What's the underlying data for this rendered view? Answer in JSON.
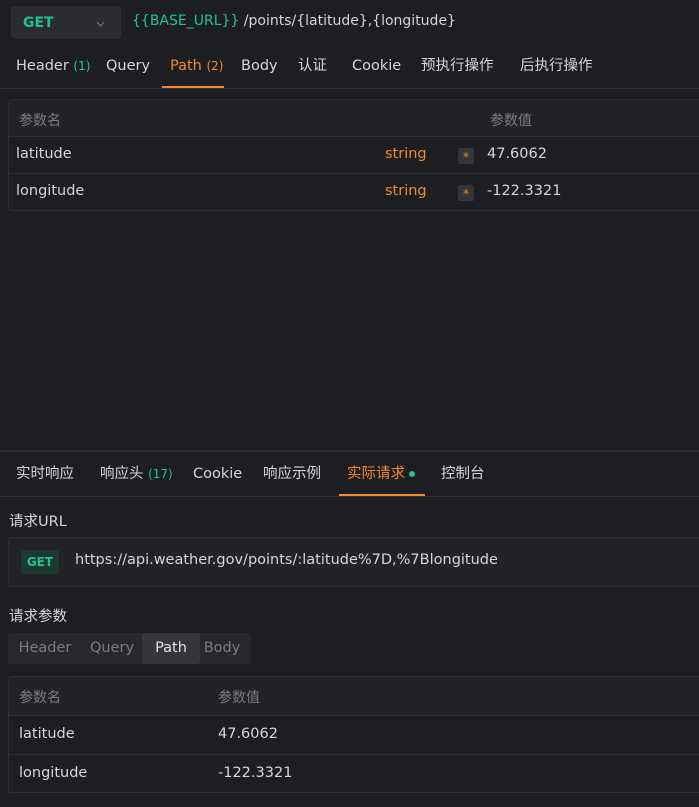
{
  "request": {
    "method": "GET",
    "url_base": "{{BASE_URL}}",
    "url_path": " /points/{latitude},{longitude}"
  },
  "request_tabs": [
    {
      "label": "Header",
      "count": "(1)"
    },
    {
      "label": "Query",
      "count": ""
    },
    {
      "label": "Path",
      "count": "(2)"
    },
    {
      "label": "Body",
      "count": ""
    },
    {
      "label": "认证",
      "count": ""
    },
    {
      "label": "Cookie",
      "count": ""
    },
    {
      "label": "预执行操作",
      "count": ""
    },
    {
      "label": "后执行操作",
      "count": ""
    }
  ],
  "active_request_tab": "Path",
  "path_params": {
    "col_name": "参数名",
    "col_value": "参数值",
    "rows": [
      {
        "name": "latitude",
        "type": "string",
        "required": "*",
        "value": "47.6062"
      },
      {
        "name": "longitude",
        "type": "string",
        "required": "*",
        "value": "-122.3321"
      }
    ]
  },
  "response_tabs": [
    {
      "label": "实时响应",
      "count": ""
    },
    {
      "label": "响应头",
      "count": "(17)"
    },
    {
      "label": "Cookie",
      "count": ""
    },
    {
      "label": "响应示例",
      "count": ""
    },
    {
      "label": "实际请求",
      "count": ""
    },
    {
      "label": "控制台",
      "count": ""
    }
  ],
  "active_response_tab": "实际请求",
  "actual_request": {
    "url_label": "请求URL",
    "method_badge": "GET",
    "url": "https://api.weather.gov/points/:latitude%7D,%7Blongitude",
    "params_label": "请求参数",
    "segments": [
      "Header",
      "Query",
      "Path",
      "Body"
    ],
    "active_segment": "Path",
    "table": {
      "col_name": "参数名",
      "col_value": "参数值",
      "rows": [
        {
          "name": "latitude",
          "value": "47.6062"
        },
        {
          "name": "longitude",
          "value": "-122.3321"
        }
      ]
    }
  },
  "colors": {
    "accent_orange": "#f28a2b",
    "accent_green": "#1fc393",
    "background": "#1d1e22"
  }
}
